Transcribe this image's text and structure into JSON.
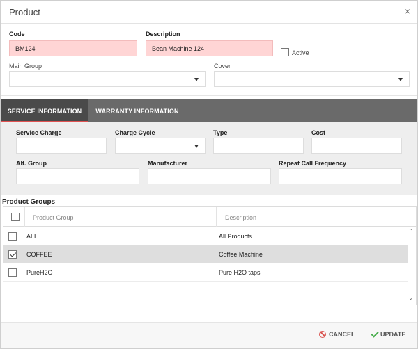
{
  "dialog": {
    "title": "Product",
    "close_glyph": "×"
  },
  "form": {
    "code_label": "Code",
    "code_value": "BM124",
    "description_label": "Description",
    "description_value": "Bean Machine 124",
    "active_label": "Active",
    "main_group_label": "Main Group",
    "cover_label": "Cover"
  },
  "tabs": {
    "service": "SERVICE INFORMATION",
    "warranty": "WARRANTY INFORMATION"
  },
  "service": {
    "service_charge_label": "Service Charge",
    "charge_cycle_label": "Charge Cycle",
    "type_label": "Type",
    "cost_label": "Cost",
    "alt_group_label": "Alt. Group",
    "manufacturer_label": "Manufacturer",
    "repeat_call_label": "Repeat Call Frequency"
  },
  "product_groups": {
    "title": "Product Groups",
    "col_group": "Product Group",
    "col_description": "Description",
    "rows": [
      {
        "group": "ALL",
        "description": "All Products",
        "checked": false
      },
      {
        "group": "COFFEE",
        "description": "Coffee Machine",
        "checked": true
      },
      {
        "group": "PureH2O",
        "description": "Pure H2O taps",
        "checked": false
      }
    ]
  },
  "footer": {
    "cancel": "CANCEL",
    "update": "UPDATE"
  },
  "colors": {
    "error_bg": "#ffd5d5",
    "tab_bar": "#6a6a6a",
    "tab_active": "#4a4a4a",
    "tab_underline": "#e05252",
    "cancel_icon": "#d9534f",
    "update_icon": "#4caf50"
  }
}
